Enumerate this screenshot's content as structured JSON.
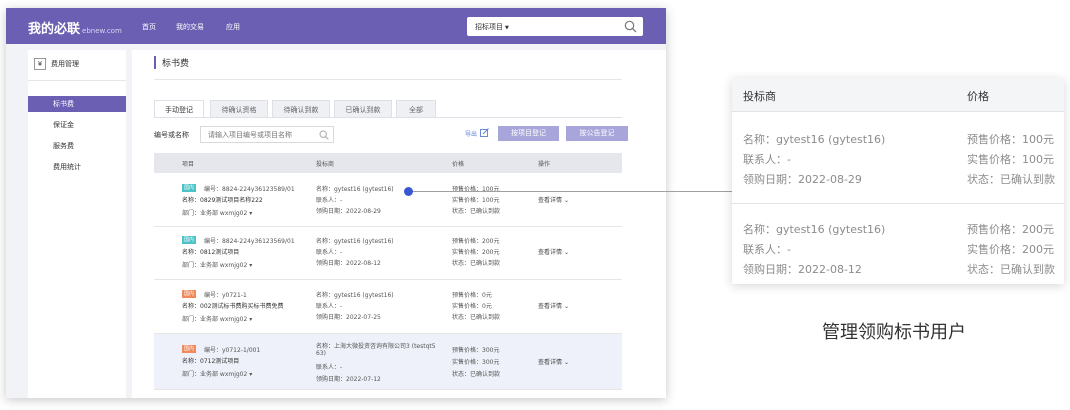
{
  "app": {
    "logo": "我的必联",
    "logo_sub": "ebnew.com",
    "nav": [
      "首页",
      "我的交易",
      "应用"
    ],
    "search_select": "招标项目"
  },
  "sidebar": {
    "header": "费用管理",
    "header_icon": "yen-icon",
    "items": [
      "标书费",
      "保证金",
      "服务费",
      "费用统计"
    ],
    "active_index": 0
  },
  "main": {
    "title": "标书费",
    "tabs": [
      "手动登记",
      "待确认资格",
      "待确认到款",
      "已确认到款",
      "全部"
    ],
    "active_tab": 0,
    "filter_label": "编号或名称",
    "filter_placeholder": "请输入项目编号或项目名称",
    "export_label": "导出",
    "btn_register": "按项目登记",
    "btn_notice": "按公告登记",
    "columns": [
      "项目",
      "投标商",
      "价格",
      "操作"
    ],
    "rows": [
      {
        "badge": "国内",
        "badge_color": "#4cc3c9",
        "code": "编号：8824-224y36123589/01",
        "name": "名称：0829测试项目名称222",
        "dept": "部门：业务部  wxmjg02",
        "bidder": "名称：gytest16 (gytest16)",
        "contact": "联系人：-",
        "date": "领购日期：2022-08-29",
        "presale": "预售价格：100元",
        "actual": "实售价格：100元",
        "status": "状态：已确认到款",
        "action": "查看详情"
      },
      {
        "badge": "国内",
        "badge_color": "#4cc3c9",
        "code": "编号：8824-224y36123569/01",
        "name": "名称：0812测试项目",
        "dept": "部门：业务部  wxmjg02",
        "bidder": "名称：gytest16 (gytest16)",
        "contact": "联系人：-",
        "date": "领购日期：2022-08-12",
        "presale": "预售价格：200元",
        "actual": "实售价格：200元",
        "status": "状态：已确认到款",
        "action": "查看详情"
      },
      {
        "badge": "国内",
        "badge_color": "#f08a5d",
        "code": "编号：y0721-1",
        "name": "名称：002测试标书费购买标书费免费",
        "dept": "部门：业务部  wxmjg02",
        "bidder": "名称：gytest16 (gytest16)",
        "contact": "联系人：-",
        "date": "领购日期：2022-07-25",
        "presale": "预售价格：0元",
        "actual": "实售价格：0元",
        "status": "状态：已确认到款",
        "action": "查看详情"
      },
      {
        "badge": "国内",
        "badge_color": "#f08a5d",
        "code": "编号：y0712-1/001",
        "name": "名称：0712测试项目",
        "dept": "部门：业务部  wxmjg02",
        "bidder": "名称：上海大微投资咨询有限公司3 (testqt5",
        "bidder2": "63)",
        "contact": "联系人：-",
        "date": "领购日期：2022-07-12",
        "presale": "预售价格：300元",
        "actual": "实售价格：300元",
        "status": "状态：已确认到款",
        "action": "查看详情"
      }
    ]
  },
  "callout": {
    "headers": [
      "投标商",
      "价格"
    ],
    "records": [
      {
        "name": "名称：gytest16 (gytest16)",
        "contact": "联系人：-",
        "date": "领购日期：2022-08-29",
        "presale": "预售价格：100元",
        "actual": "实售价格：100元",
        "status": "状态：已确认到款"
      },
      {
        "name": "名称：gytest16 (gytest16)",
        "contact": "联系人：-",
        "date": "领购日期：2022-08-12",
        "presale": "预售价格：200元",
        "actual": "实售价格：200元",
        "status": "状态：已确认到款"
      }
    ],
    "caption": "管理领购标书用户"
  },
  "colors": {
    "brand": "#6a5fb3",
    "button": "#a8a5da",
    "marker": "#3a56d4"
  }
}
